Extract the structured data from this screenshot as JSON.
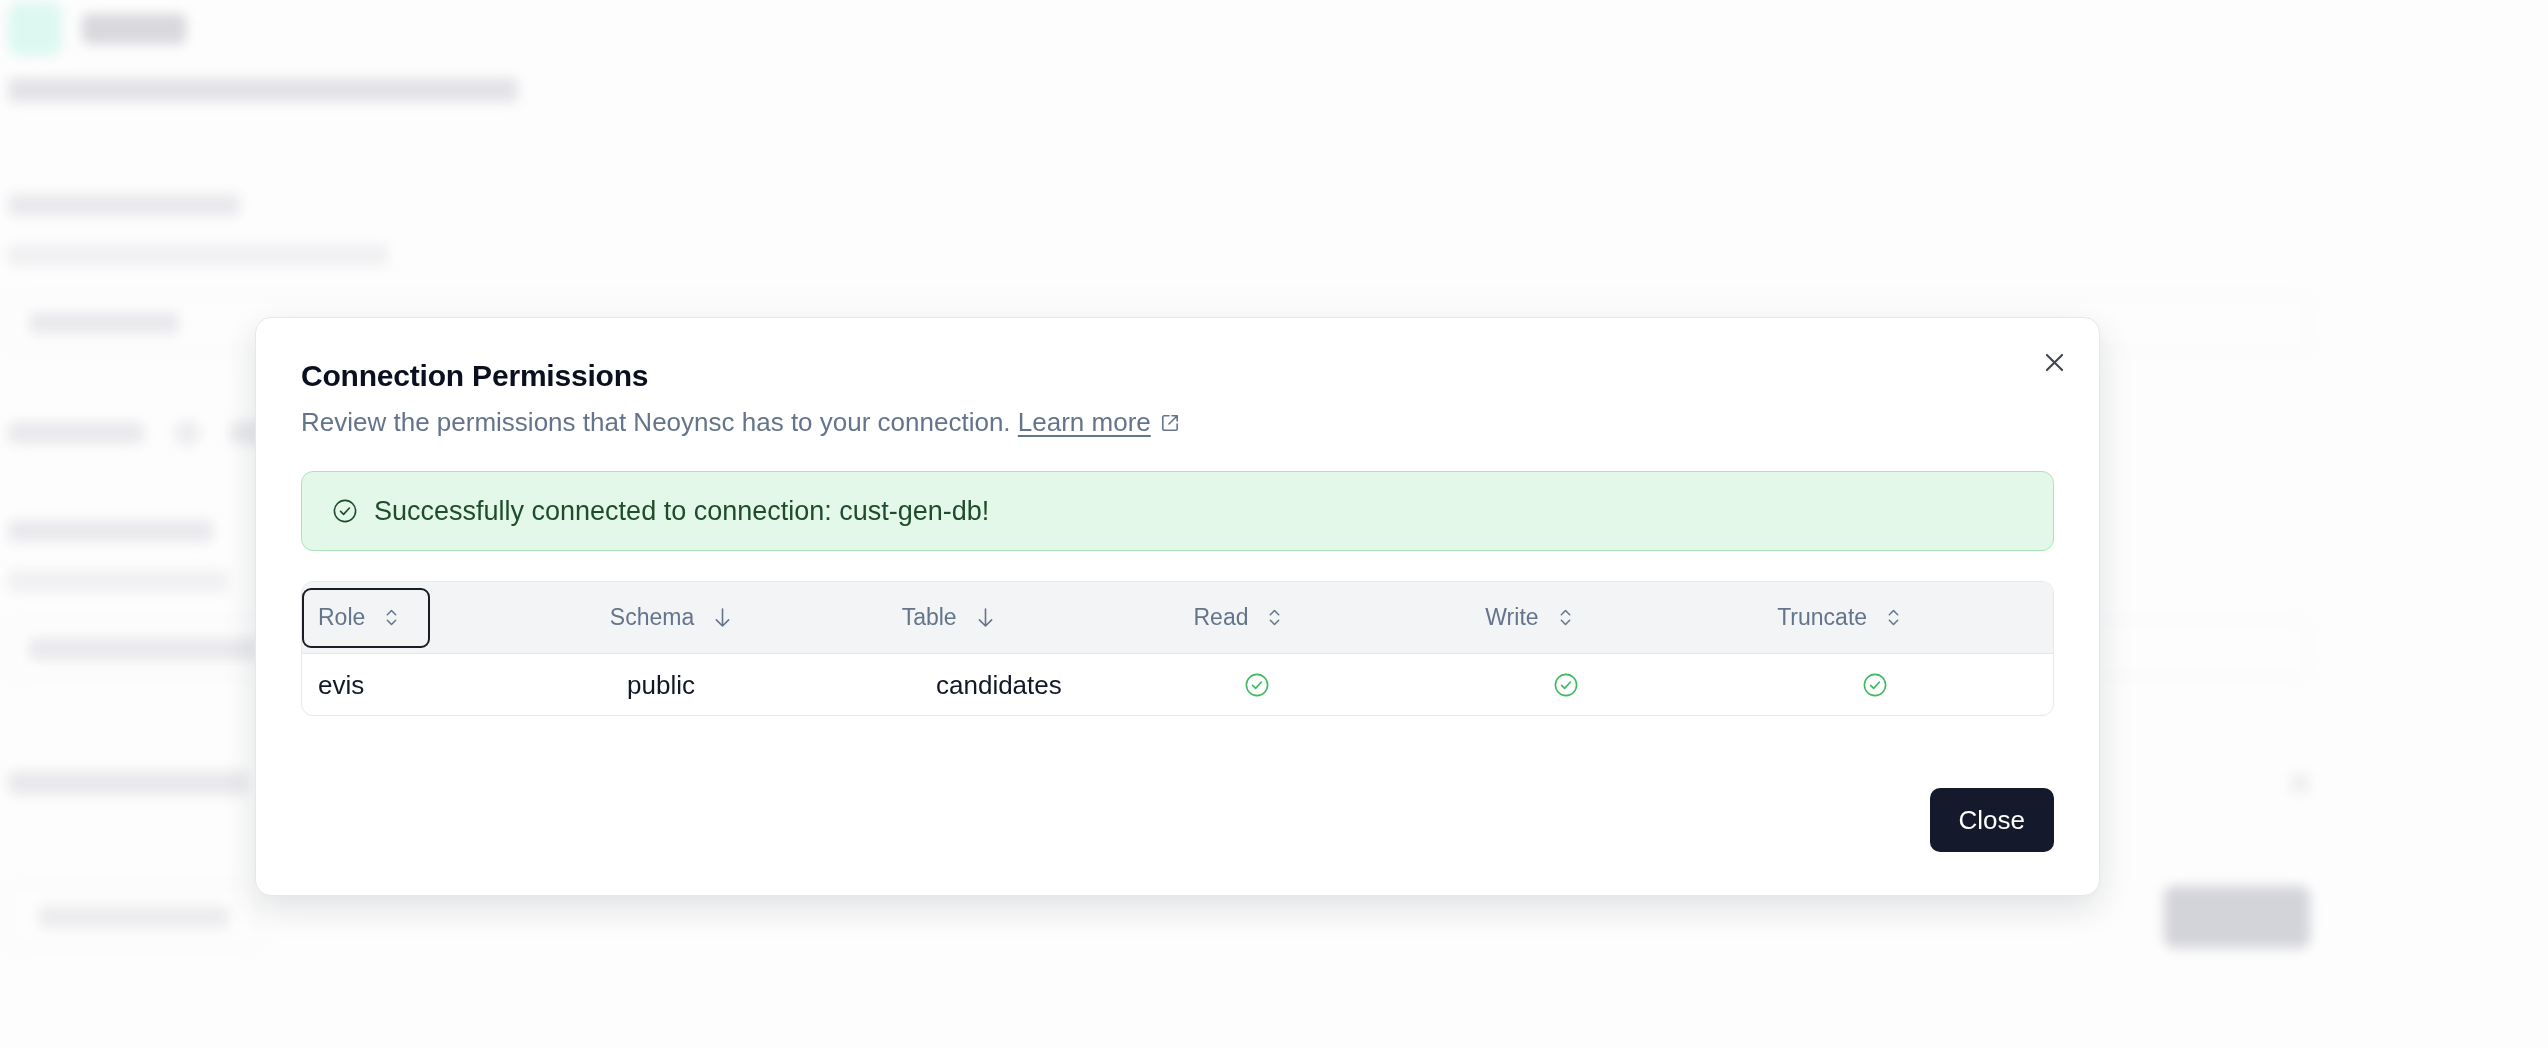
{
  "dialog": {
    "title": "Connection Permissions",
    "description": "Review the permissions that Neoynsc has to your connection.",
    "link": {
      "label": "Learn more"
    },
    "alert": {
      "kind": "success",
      "message": "Successfully connected to connection: cust-gen-db!"
    },
    "table": {
      "columns": [
        {
          "label": "Role",
          "sorted": false,
          "focused": true
        },
        {
          "label": "Schema",
          "sorted": true,
          "focused": false
        },
        {
          "label": "Table",
          "sorted": true,
          "focused": false
        },
        {
          "label": "Read",
          "sorted": false,
          "focused": false
        },
        {
          "label": "Write",
          "sorted": false,
          "focused": false
        },
        {
          "label": "Truncate",
          "sorted": false,
          "focused": false
        }
      ],
      "rows": [
        {
          "cells": [
            {
              "kind": "text",
              "text": "evis"
            },
            {
              "kind": "text",
              "text": "public"
            },
            {
              "kind": "text",
              "text": "candidates"
            },
            {
              "kind": "permission",
              "granted": true
            },
            {
              "kind": "permission",
              "granted": true
            },
            {
              "kind": "permission",
              "granted": true
            }
          ]
        }
      ]
    },
    "buttons": [
      {
        "label": "Close",
        "kind": "primary"
      }
    ]
  }
}
